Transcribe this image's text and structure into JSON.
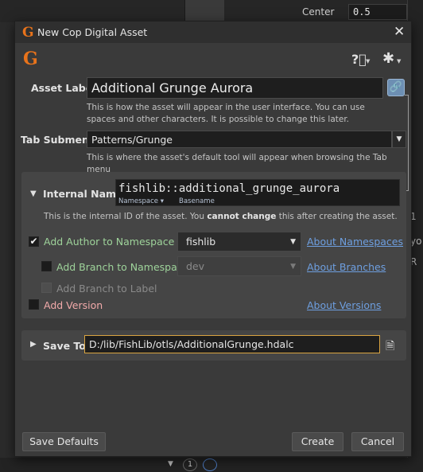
{
  "background": {
    "center_label": "Center",
    "center_value": "0.5",
    "right_fragments": [
      "1",
      "yo",
      "R"
    ],
    "bottom_ctrl": "1"
  },
  "dialog": {
    "title": "New Cop Digital Asset",
    "logo_glyph": "G",
    "asset_label": {
      "label": "Asset Label",
      "value": "Additional Grunge Aurora",
      "help": "This is how the asset will appear in the user interface. You can use spaces and other characters. It is possible to change this later."
    },
    "tab_submenu": {
      "label": "Tab Submenu",
      "value": "Patterns/Grunge",
      "help": "This is where the asset's default tool will appear when browsing the Tab menu"
    },
    "internal_name": {
      "label": "Internal Name",
      "value": "fishlib::additional_grunge_aurora",
      "namespace_sub": "Namespace",
      "basename_sub": "Basename",
      "help_pre": "This is the internal ID of the asset. You ",
      "help_bold": "cannot change",
      "help_post": " this after creating the asset."
    },
    "options": {
      "add_author": {
        "label": "Add Author to Namespace",
        "checked": true,
        "combo": "fishlib",
        "link": "About Namespaces"
      },
      "add_branch_ns": {
        "label": "Add Branch to Namespace",
        "checked": false,
        "combo": "dev",
        "link": "About Branches"
      },
      "add_branch_label": {
        "label": "Add Branch to Label",
        "checked": false
      },
      "add_version": {
        "label": "Add Version",
        "checked": false,
        "link": "About Versions"
      }
    },
    "save_to": {
      "label": "Save To",
      "value": "D:/lib/FishLib/otls/AdditionalGrunge.hdalc"
    },
    "buttons": {
      "save_defaults": "Save Defaults",
      "create": "Create",
      "cancel": "Cancel"
    },
    "colors": {
      "accent_orange": "#e8731b",
      "link_blue": "#6e9fe0",
      "green_label": "#9ed39a",
      "red_label": "#f2aaaa",
      "focus_border": "#d9a441"
    }
  }
}
